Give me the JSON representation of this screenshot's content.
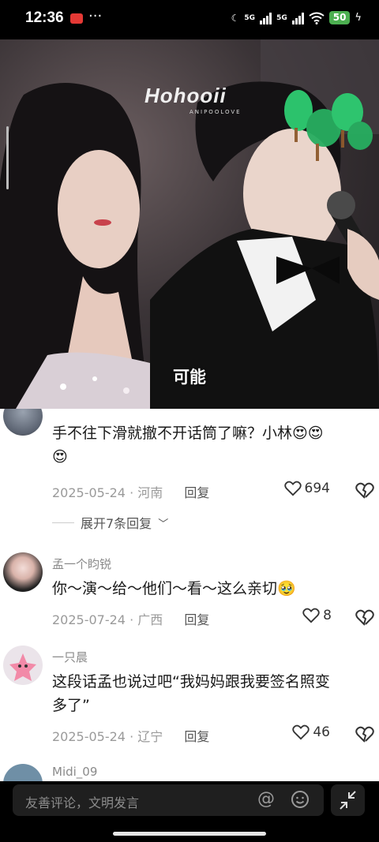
{
  "status_bar": {
    "time": "12:36",
    "more": "···",
    "network1": "5G",
    "network2": "5G",
    "battery": "50"
  },
  "video": {
    "watermark": "Hohooii",
    "watermark_sub": "ANIPOOLOVE",
    "subtitle": "可能"
  },
  "comments": [
    {
      "username": "",
      "text_line1": "手不往下滑就撤不开话筒了嘛？小林😍😍",
      "text_line2": "😍",
      "date": "2025-05-24",
      "location": "河南",
      "reply_label": "回复",
      "likes": "694",
      "expand_label": "展开7条回复"
    },
    {
      "username": "孟一个盷锐",
      "text_line1": "你～演～给～他们～看～这么亲切🥹",
      "date": "2025-07-24",
      "location": "广西",
      "reply_label": "回复",
      "likes": "8"
    },
    {
      "username": "一只晨",
      "text_line1": "这段话孟也说过吧“我妈妈跟我要签名照变",
      "text_line2": "多了”",
      "date": "2025-05-24",
      "location": "辽宁",
      "reply_label": "回复",
      "likes": "46"
    },
    {
      "username": "Midi_09"
    }
  ],
  "input": {
    "placeholder": "友善评论，文明发言",
    "at_symbol": "@"
  },
  "colors": {
    "battery": "#4caf50",
    "record": "#e53935",
    "background": "#000000",
    "comment_panel": "#ffffff"
  }
}
